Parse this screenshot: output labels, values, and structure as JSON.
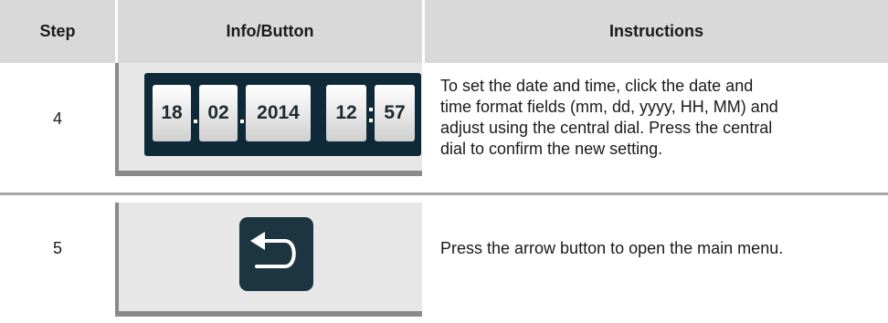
{
  "header": {
    "step": "Step",
    "info_button": "Info/Button",
    "instructions": "Instructions"
  },
  "rows": [
    {
      "step": "4",
      "datetime": {
        "day": "18",
        "month": "02",
        "year": "2014",
        "hour": "12",
        "minute": "57"
      },
      "instructions": [
        "To set the date and time, click the date and",
        "time format fields (mm, dd, yyyy, HH, MM) and",
        "adjust using the central dial. Press the central",
        "dial to confirm the new setting."
      ]
    },
    {
      "step": "5",
      "button_icon": "return-arrow-icon",
      "instructions": [
        "Press the arrow button to open the main menu."
      ]
    }
  ],
  "colors": {
    "header_bg": "#d9d9d9",
    "panel_bg": "#e7e7e7",
    "panel_shadow": "#8a8a8a",
    "display_bg": "#0e2a38",
    "button_bg": "#1c3540",
    "separator": "#a7a7a7"
  }
}
